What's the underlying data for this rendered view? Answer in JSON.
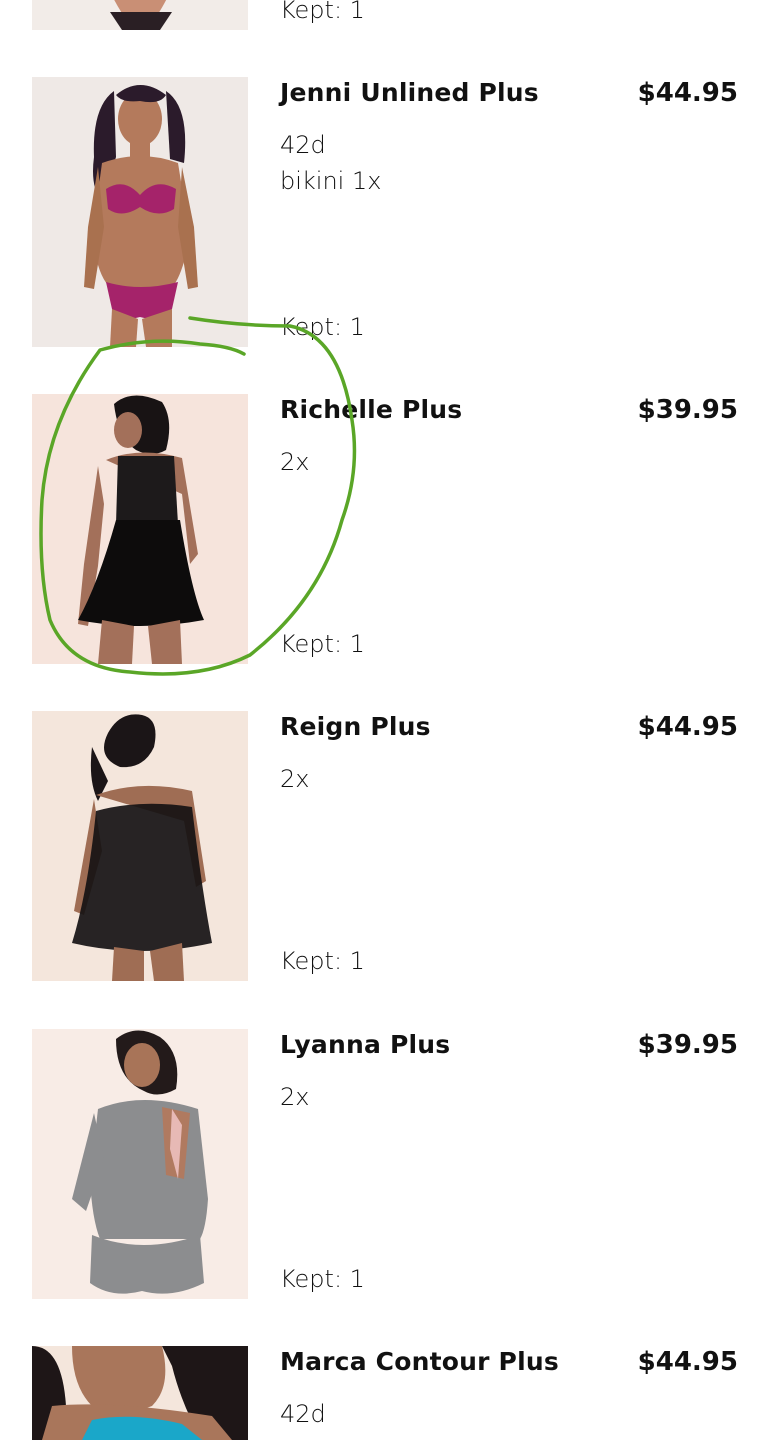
{
  "items": [
    {
      "kept": "Kept: 1"
    },
    {
      "name": "Jenni Unlined Plus",
      "price": "$44.95",
      "variant_line1": "42d",
      "variant_line2": "bikini 1x",
      "kept": "Kept: 1"
    },
    {
      "name": "Richelle Plus",
      "price": "$39.95",
      "variant_line1": "2x",
      "kept": "Kept: 1"
    },
    {
      "name": "Reign Plus",
      "price": "$44.95",
      "variant_line1": "2x",
      "kept": "Kept: 1"
    },
    {
      "name": "Lyanna Plus",
      "price": "$39.95",
      "variant_line1": "2x",
      "kept": "Kept: 1"
    },
    {
      "name": "Marca Contour Plus",
      "price": "$44.95",
      "variant_line1": "42d"
    }
  ],
  "annotation": {
    "color": "#5aa627"
  }
}
